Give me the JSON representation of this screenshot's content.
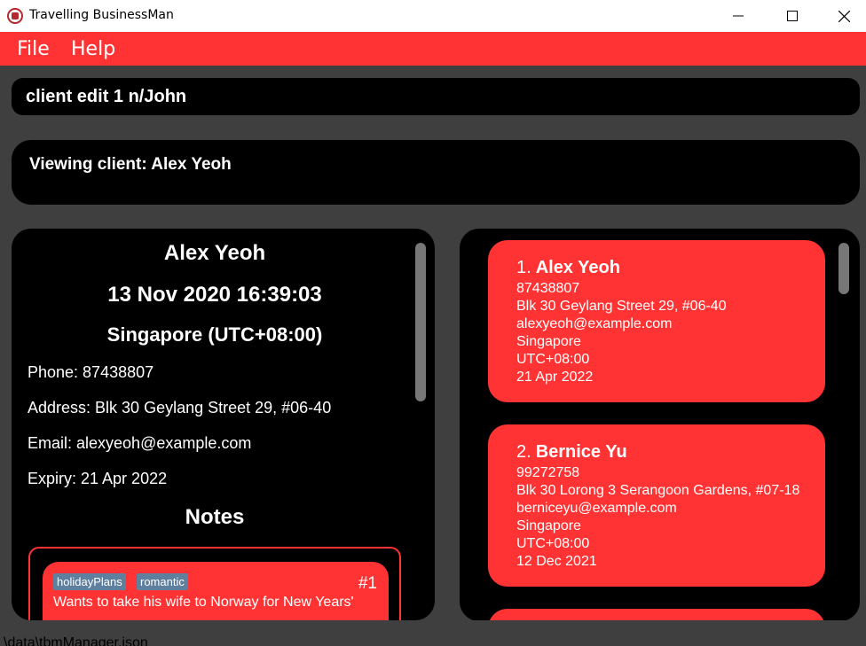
{
  "window": {
    "title": "Travelling BusinessMan",
    "minimize": "─",
    "maximize": "☐",
    "close": "✕"
  },
  "menu": {
    "file": "File",
    "help": "Help"
  },
  "command": {
    "value": "client edit 1 n/John"
  },
  "result": {
    "text": "Viewing client: Alex Yeoh"
  },
  "detail": {
    "name": "Alex Yeoh",
    "datetime": "13 Nov 2020 16:39:03",
    "timezone": "Singapore (UTC+08:00)",
    "phone": "Phone: 87438807",
    "address": "Address: Blk 30 Geylang Street 29, #06-40",
    "email": "Email: alexyeoh@example.com",
    "expiry": "Expiry: 21 Apr 2022",
    "notes_heading": "Notes",
    "note": {
      "tags": [
        "holidayPlans",
        "romantic"
      ],
      "number": "#1",
      "text": "Wants to take his wife to Norway for New Years'"
    }
  },
  "clients": [
    {
      "index": "1.",
      "name": "Alex Yeoh",
      "phone": "87438807",
      "address": "Blk 30 Geylang Street 29, #06-40",
      "email": "alexyeoh@example.com",
      "country": "Singapore",
      "timezone": "UTC+08:00",
      "expiry": "21 Apr 2022"
    },
    {
      "index": "2.",
      "name": "Bernice Yu",
      "phone": "99272758",
      "address": "Blk 30 Lorong 3 Serangoon Gardens, #07-18",
      "email": "berniceyu@example.com",
      "country": "Singapore",
      "timezone": "UTC+08:00",
      "expiry": "12 Dec 2021"
    }
  ],
  "status": {
    "path": "\\data\\tbmManager.json"
  },
  "colors": {
    "accent": "#ff3333",
    "panel": "#000000",
    "background": "#3f3f3f",
    "tag": "#5f7f9f"
  }
}
